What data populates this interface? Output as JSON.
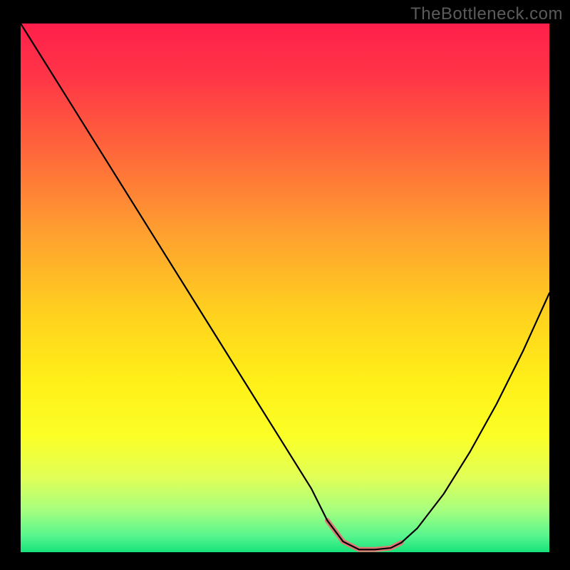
{
  "watermark": "TheBottleneck.com",
  "chart_data": {
    "type": "line",
    "title": "",
    "xlabel": "",
    "ylabel": "",
    "xlim": [
      0,
      100
    ],
    "ylim": [
      0,
      100
    ],
    "background_gradient": {
      "stops": [
        {
          "offset": 0.0,
          "color": "#ff1f4b"
        },
        {
          "offset": 0.1,
          "color": "#ff3547"
        },
        {
          "offset": 0.25,
          "color": "#ff6a3a"
        },
        {
          "offset": 0.4,
          "color": "#ffa12f"
        },
        {
          "offset": 0.55,
          "color": "#ffd21e"
        },
        {
          "offset": 0.68,
          "color": "#fff018"
        },
        {
          "offset": 0.78,
          "color": "#fbff26"
        },
        {
          "offset": 0.86,
          "color": "#e0ff58"
        },
        {
          "offset": 0.92,
          "color": "#a7ff7e"
        },
        {
          "offset": 0.97,
          "color": "#55f58e"
        },
        {
          "offset": 1.0,
          "color": "#17e27a"
        }
      ]
    },
    "series": [
      {
        "name": "bottleneck-curve",
        "color": "#000000",
        "width": 2.2,
        "x": [
          0,
          5,
          10,
          15,
          20,
          25,
          30,
          35,
          40,
          45,
          50,
          55,
          58,
          61,
          64,
          67,
          70,
          72,
          75,
          80,
          85,
          90,
          95,
          100
        ],
        "y": [
          100,
          92,
          84,
          76,
          68,
          60,
          52,
          44,
          36,
          28,
          20,
          12,
          6,
          2,
          0.5,
          0.5,
          0.8,
          1.8,
          4.5,
          11,
          19,
          28,
          38,
          49
        ]
      }
    ],
    "flat_region": {
      "color": "#dd7a73",
      "width": 7,
      "x": [
        58,
        61,
        64,
        67,
        70,
        72
      ],
      "y": [
        6,
        2,
        0.5,
        0.5,
        0.8,
        1.8
      ]
    }
  }
}
